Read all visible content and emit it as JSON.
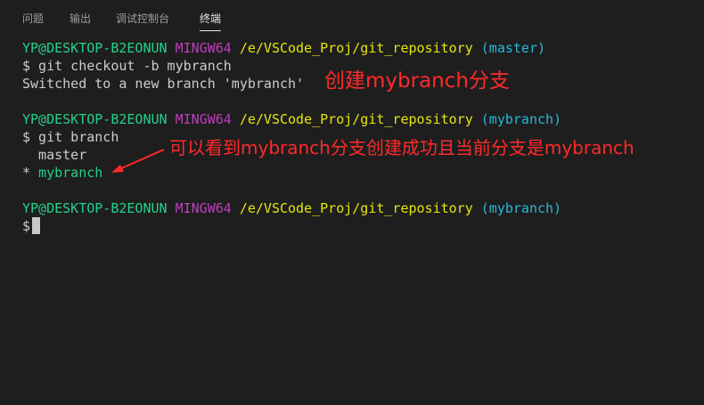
{
  "tabs": [
    {
      "label": "问题"
    },
    {
      "label": "输出"
    },
    {
      "label": "调试控制台"
    },
    {
      "label": "终端",
      "active": true
    }
  ],
  "terminal": {
    "prompt1": {
      "user": "YP@DESKTOP-B2EONUN",
      "env": "MINGW64",
      "path": "/e/VSCode_Proj/git_repository",
      "branch": "(master)"
    },
    "cmd1": "$ git checkout -b mybranch",
    "out1": "Switched to a new branch 'mybranch'",
    "prompt2": {
      "user": "YP@DESKTOP-B2EONUN",
      "env": "MINGW64",
      "path": "/e/VSCode_Proj/git_repository",
      "branch": "(mybranch)"
    },
    "cmd2": "$ git branch",
    "branch_list": [
      {
        "text": "  master"
      },
      {
        "marker": "* ",
        "name": "mybranch"
      }
    ],
    "prompt3": {
      "user": "YP@DESKTOP-B2EONUN",
      "env": "MINGW64",
      "path": "/e/VSCode_Proj/git_repository",
      "branch": "(mybranch)"
    },
    "cmd3": "$"
  },
  "annotations": {
    "note1": "创建mybranch分支",
    "note2": "可以看到mybranch分支创建成功且当前分支是mybranch"
  },
  "colors": {
    "background": "#1e1e1e",
    "user_green": "#23d18b",
    "mingw_magenta": "#bc3fbc",
    "path_yellow": "#e5e510",
    "branch_cyan": "#29b8db",
    "annotation_red": "#ff2a2a"
  }
}
